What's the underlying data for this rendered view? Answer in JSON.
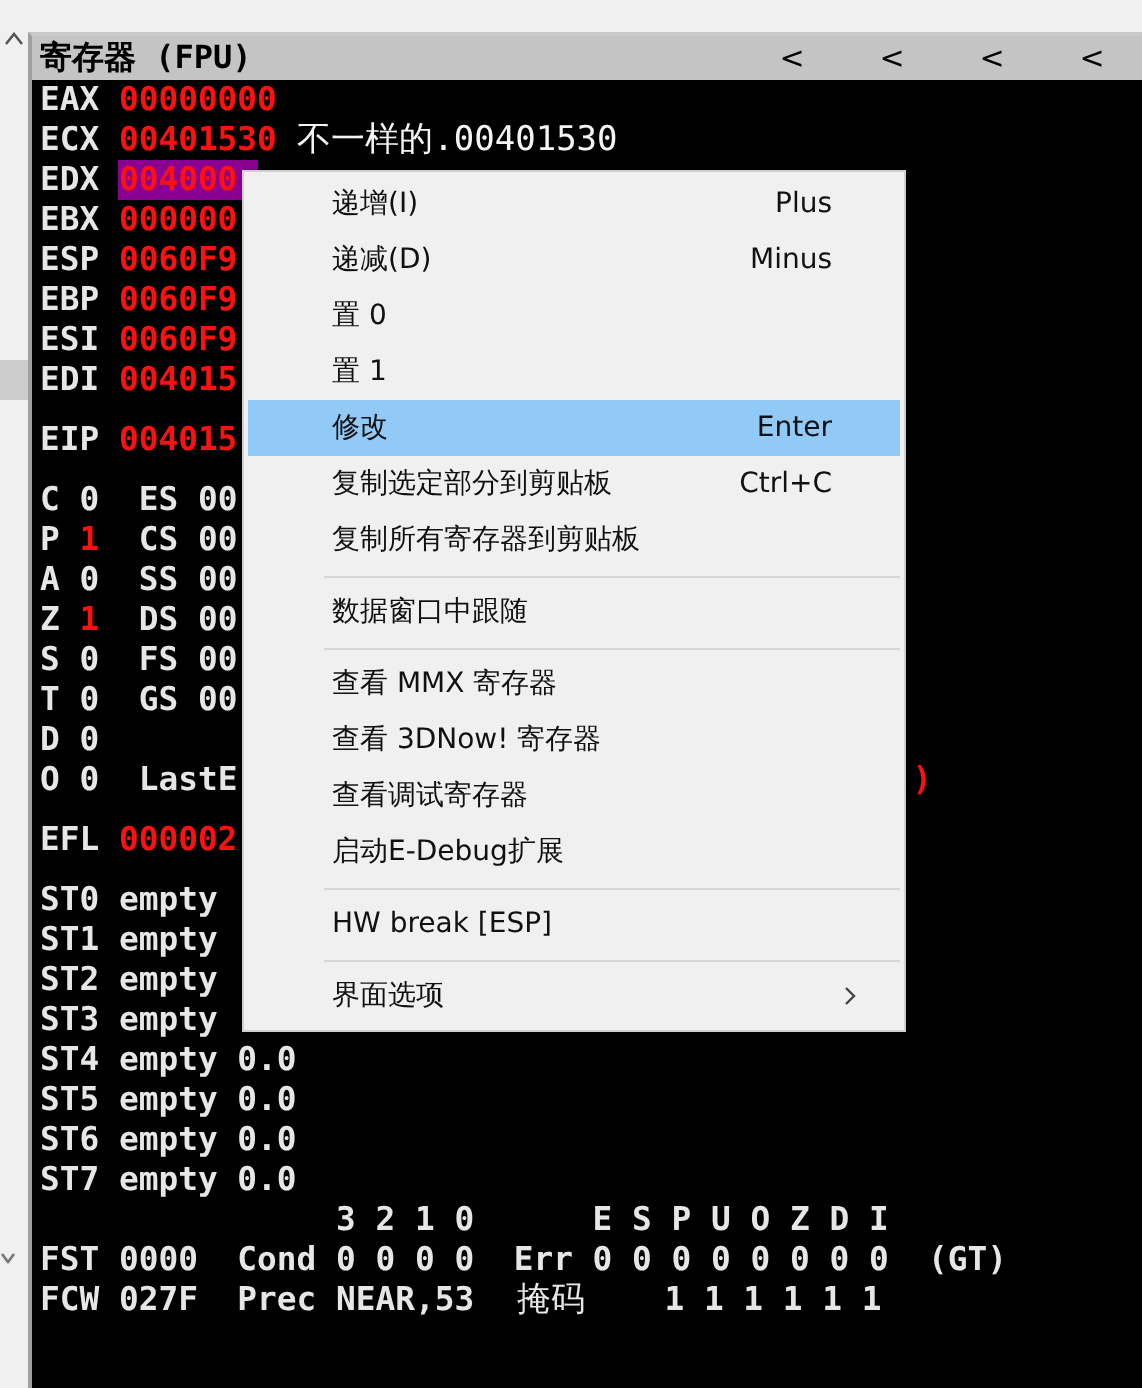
{
  "panel": {
    "title": "寄存器 (FPU)",
    "header_buttons": [
      "<",
      "<",
      "<",
      "<"
    ]
  },
  "register_groups": [
    {
      "rows": [
        {
          "kind": "reg",
          "name": "EAX",
          "value": "00000000",
          "changed": true,
          "highlighted": false
        },
        {
          "kind": "reg",
          "name": "ECX",
          "value": "00401530",
          "changed": true,
          "highlighted": false,
          "comment": "不一样的.00401530"
        },
        {
          "kind": "reg",
          "name": "EDX",
          "value": "004000",
          "changed": true,
          "highlighted": true
        },
        {
          "kind": "reg",
          "name": "EBX",
          "value": "000000",
          "changed": true,
          "highlighted": false
        },
        {
          "kind": "reg",
          "name": "ESP",
          "value": "0060F9",
          "changed": true,
          "highlighted": false
        },
        {
          "kind": "reg",
          "name": "EBP",
          "value": "0060F9",
          "changed": true,
          "highlighted": false
        },
        {
          "kind": "reg",
          "name": "ESI",
          "value": "0060F9",
          "changed": true,
          "highlighted": false
        },
        {
          "kind": "reg",
          "name": "EDI",
          "value": "004015",
          "changed": true,
          "highlighted": false
        }
      ]
    },
    {
      "rows": [
        {
          "kind": "reg",
          "name": "EIP",
          "value": "004015",
          "changed": true,
          "highlighted": false
        }
      ]
    },
    {
      "rows": [
        {
          "kind": "flag",
          "name": "C",
          "value": "0",
          "changed": false,
          "segment": "ES 00"
        },
        {
          "kind": "flag",
          "name": "P",
          "value": "1",
          "changed": true,
          "segment": "CS 00"
        },
        {
          "kind": "flag",
          "name": "A",
          "value": "0",
          "changed": false,
          "segment": "SS 00"
        },
        {
          "kind": "flag",
          "name": "Z",
          "value": "1",
          "changed": true,
          "segment": "DS 00"
        },
        {
          "kind": "flag",
          "name": "S",
          "value": "0",
          "changed": false,
          "segment": "FS 00"
        },
        {
          "kind": "flag",
          "name": "T",
          "value": "0",
          "changed": false,
          "segment": "GS 00"
        },
        {
          "kind": "flag",
          "name": "D",
          "value": "0",
          "changed": false
        },
        {
          "kind": "flag",
          "name": "O",
          "value": "0",
          "changed": false,
          "segment": "LastE",
          "tail": {
            "text": ")",
            "changed": true
          }
        }
      ]
    },
    {
      "rows": [
        {
          "kind": "reg",
          "name": "EFL",
          "value": "000002",
          "changed": true,
          "highlighted": false
        }
      ]
    },
    {
      "rows": [
        {
          "kind": "plain",
          "text": "ST0 empty"
        },
        {
          "kind": "plain",
          "text": "ST1 empty"
        },
        {
          "kind": "plain",
          "text": "ST2 empty"
        },
        {
          "kind": "plain",
          "text": "ST3 empty"
        },
        {
          "kind": "plain",
          "text": "ST4 empty 0.0"
        },
        {
          "kind": "plain",
          "text": "ST5 empty 0.0"
        },
        {
          "kind": "plain",
          "text": "ST6 empty 0.0"
        },
        {
          "kind": "plain",
          "text": "ST7 empty 0.0"
        },
        {
          "kind": "bits",
          "cond": "3 2 1 0",
          "err": "E S P U O Z D I"
        },
        {
          "kind": "plain",
          "text": "FST 0000  Cond 0 0 0 0  Err 0 0 0 0 0 0 0 0  (GT)"
        },
        {
          "kind": "mask",
          "text": "FCW 027F  Prec NEAR,53",
          "label": "掩码",
          "bits": "1 1 1 1 1 1"
        }
      ]
    }
  ],
  "context_menu": {
    "items": [
      {
        "kind": "item",
        "label": "递增(I)",
        "shortcut": "Plus",
        "selected": false
      },
      {
        "kind": "item",
        "label": "递减(D)",
        "shortcut": "Minus",
        "selected": false
      },
      {
        "kind": "item",
        "label": "置 0",
        "selected": false
      },
      {
        "kind": "item",
        "label": "置 1",
        "selected": false
      },
      {
        "kind": "item",
        "label": "修改",
        "shortcut": "Enter",
        "selected": true
      },
      {
        "kind": "item",
        "label": "复制选定部分到剪贴板",
        "shortcut": "Ctrl+C",
        "selected": false
      },
      {
        "kind": "item",
        "label": "复制所有寄存器到剪贴板",
        "selected": false
      },
      {
        "kind": "separator"
      },
      {
        "kind": "item",
        "label": "数据窗口中跟随",
        "selected": false
      },
      {
        "kind": "separator"
      },
      {
        "kind": "item",
        "label": "查看 MMX 寄存器",
        "selected": false
      },
      {
        "kind": "item",
        "label": "查看 3DNow! 寄存器",
        "selected": false
      },
      {
        "kind": "item",
        "label": "查看调试寄存器",
        "selected": false
      },
      {
        "kind": "item",
        "label": "启动E-Debug扩展",
        "selected": false
      },
      {
        "kind": "separator"
      },
      {
        "kind": "item",
        "label": "HW break [ESP]",
        "selected": false
      },
      {
        "kind": "separator"
      },
      {
        "kind": "submenu",
        "label": "界面选项",
        "selected": false
      }
    ]
  }
}
